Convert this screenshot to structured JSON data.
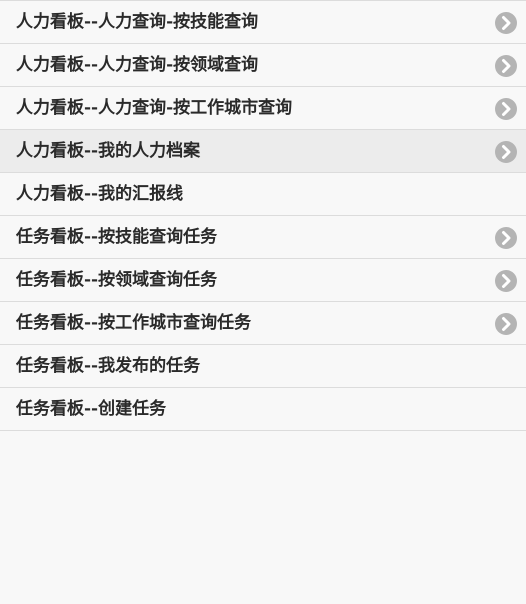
{
  "menu": {
    "items": [
      {
        "label": "人力看板--人力查询-按技能查询",
        "chevron": "chevron-right-icon"
      },
      {
        "label": "人力看板--人力查询-按领域查询",
        "chevron": "chevron-right-icon"
      },
      {
        "label": "人力看板--人力查询-按工作城市查询",
        "chevron": "chevron-right-icon"
      },
      {
        "label": "人力看板--我的人力档案",
        "chevron": "chevron-right-icon"
      },
      {
        "label": "人力看板--我的汇报线"
      },
      {
        "label": "任务看板--按技能查询任务",
        "chevron": "chevron-right-icon"
      },
      {
        "label": "任务看板--按领域查询任务",
        "chevron": "chevron-right-icon"
      },
      {
        "label": "任务看板--按工作城市查询任务",
        "chevron": "chevron-right-icon"
      },
      {
        "label": "任务看板--我发布的任务"
      },
      {
        "label": "任务看板--创建任务"
      }
    ]
  },
  "colors": {
    "background": "#f8f8f8",
    "active_row": "#ececec",
    "divider": "#dcdcdc",
    "chevron_circle": "#b4b4b4",
    "text": "#2a2a2a"
  }
}
